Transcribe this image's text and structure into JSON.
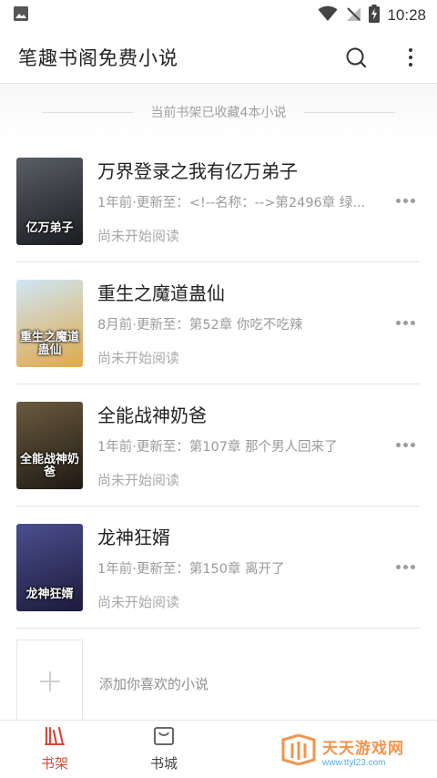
{
  "status_bar": {
    "time": "10:28",
    "icons": [
      "image-icon",
      "wifi-icon",
      "no-signal-icon",
      "battery-charging-icon"
    ]
  },
  "app_bar": {
    "title": "笔趣书阁免费小说",
    "actions": [
      "search-icon",
      "more-vertical-icon"
    ]
  },
  "shelf": {
    "count_text": "当前书架已收藏4本小说",
    "books": [
      {
        "title": "万界登录之我有亿万弟子",
        "update": "1年前·更新至：<!--名称：-->第2496章 绿...",
        "progress": "尚未开始阅读",
        "cover_text": "亿万弟子",
        "cover_colors": [
          "#5a5f66",
          "#1a1c20"
        ]
      },
      {
        "title": "重生之魔道蛊仙",
        "update": "8月前·更新至：第52章 你吃不吃辣",
        "progress": "尚未开始阅读",
        "cover_text": "重生之魔道蛊仙",
        "cover_colors": [
          "#cfe6f5",
          "#e0a94a"
        ]
      },
      {
        "title": "全能战神奶爸",
        "update": "1年前·更新至：第107章 那个男人回来了",
        "progress": "尚未开始阅读",
        "cover_text": "全能战神奶爸",
        "cover_colors": [
          "#6b5a3e",
          "#1e1a14"
        ]
      },
      {
        "title": "龙神狂婿",
        "update": "1年前·更新至：第150章 离开了",
        "progress": "尚未开始阅读",
        "cover_text": "龙神狂婿",
        "cover_colors": [
          "#4b4f8e",
          "#1c1b3a"
        ]
      }
    ],
    "add_label": "添加你喜欢的小说"
  },
  "bottom_nav": {
    "tabs": [
      {
        "label": "书架",
        "icon": "bookshelf-icon",
        "active": true
      },
      {
        "label": "书城",
        "icon": "bookstore-icon",
        "active": false
      }
    ]
  },
  "watermark": {
    "name": "天天游戏网",
    "url": "www.ttyl23.com"
  },
  "colors": {
    "accent": "#d64a3a",
    "muted_text": "#9a9a9a",
    "divider": "#e6e6e6"
  }
}
